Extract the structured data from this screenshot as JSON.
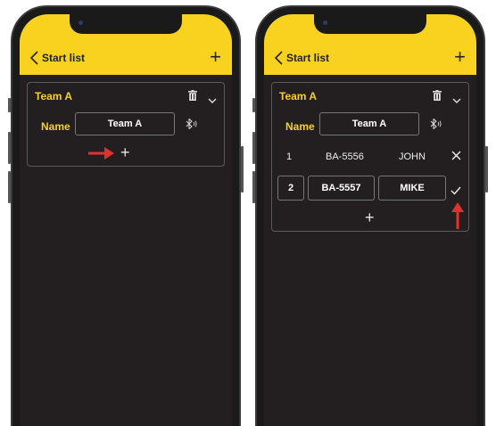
{
  "left": {
    "header": {
      "back_label": "Start list"
    },
    "team": {
      "title": "Team A",
      "name_label": "Name",
      "name_value": "Team A"
    }
  },
  "right": {
    "header": {
      "back_label": "Start list"
    },
    "team": {
      "title": "Team A",
      "name_label": "Name",
      "name_value": "Team A",
      "rows": [
        {
          "index": "1",
          "id": "BA-5556",
          "name": "JOHN"
        },
        {
          "index": "2",
          "id": "BA-5557",
          "name": "MIKE"
        }
      ]
    }
  },
  "colors": {
    "accent": "#f9d11f",
    "background": "#231f20",
    "annotation": "#e03131"
  },
  "icons": [
    "back-chevron-icon",
    "plus-icon",
    "trash-icon",
    "chevron-down-icon",
    "bluetooth-icon",
    "close-icon",
    "check-icon",
    "arrow-right-icon",
    "arrow-up-icon"
  ]
}
